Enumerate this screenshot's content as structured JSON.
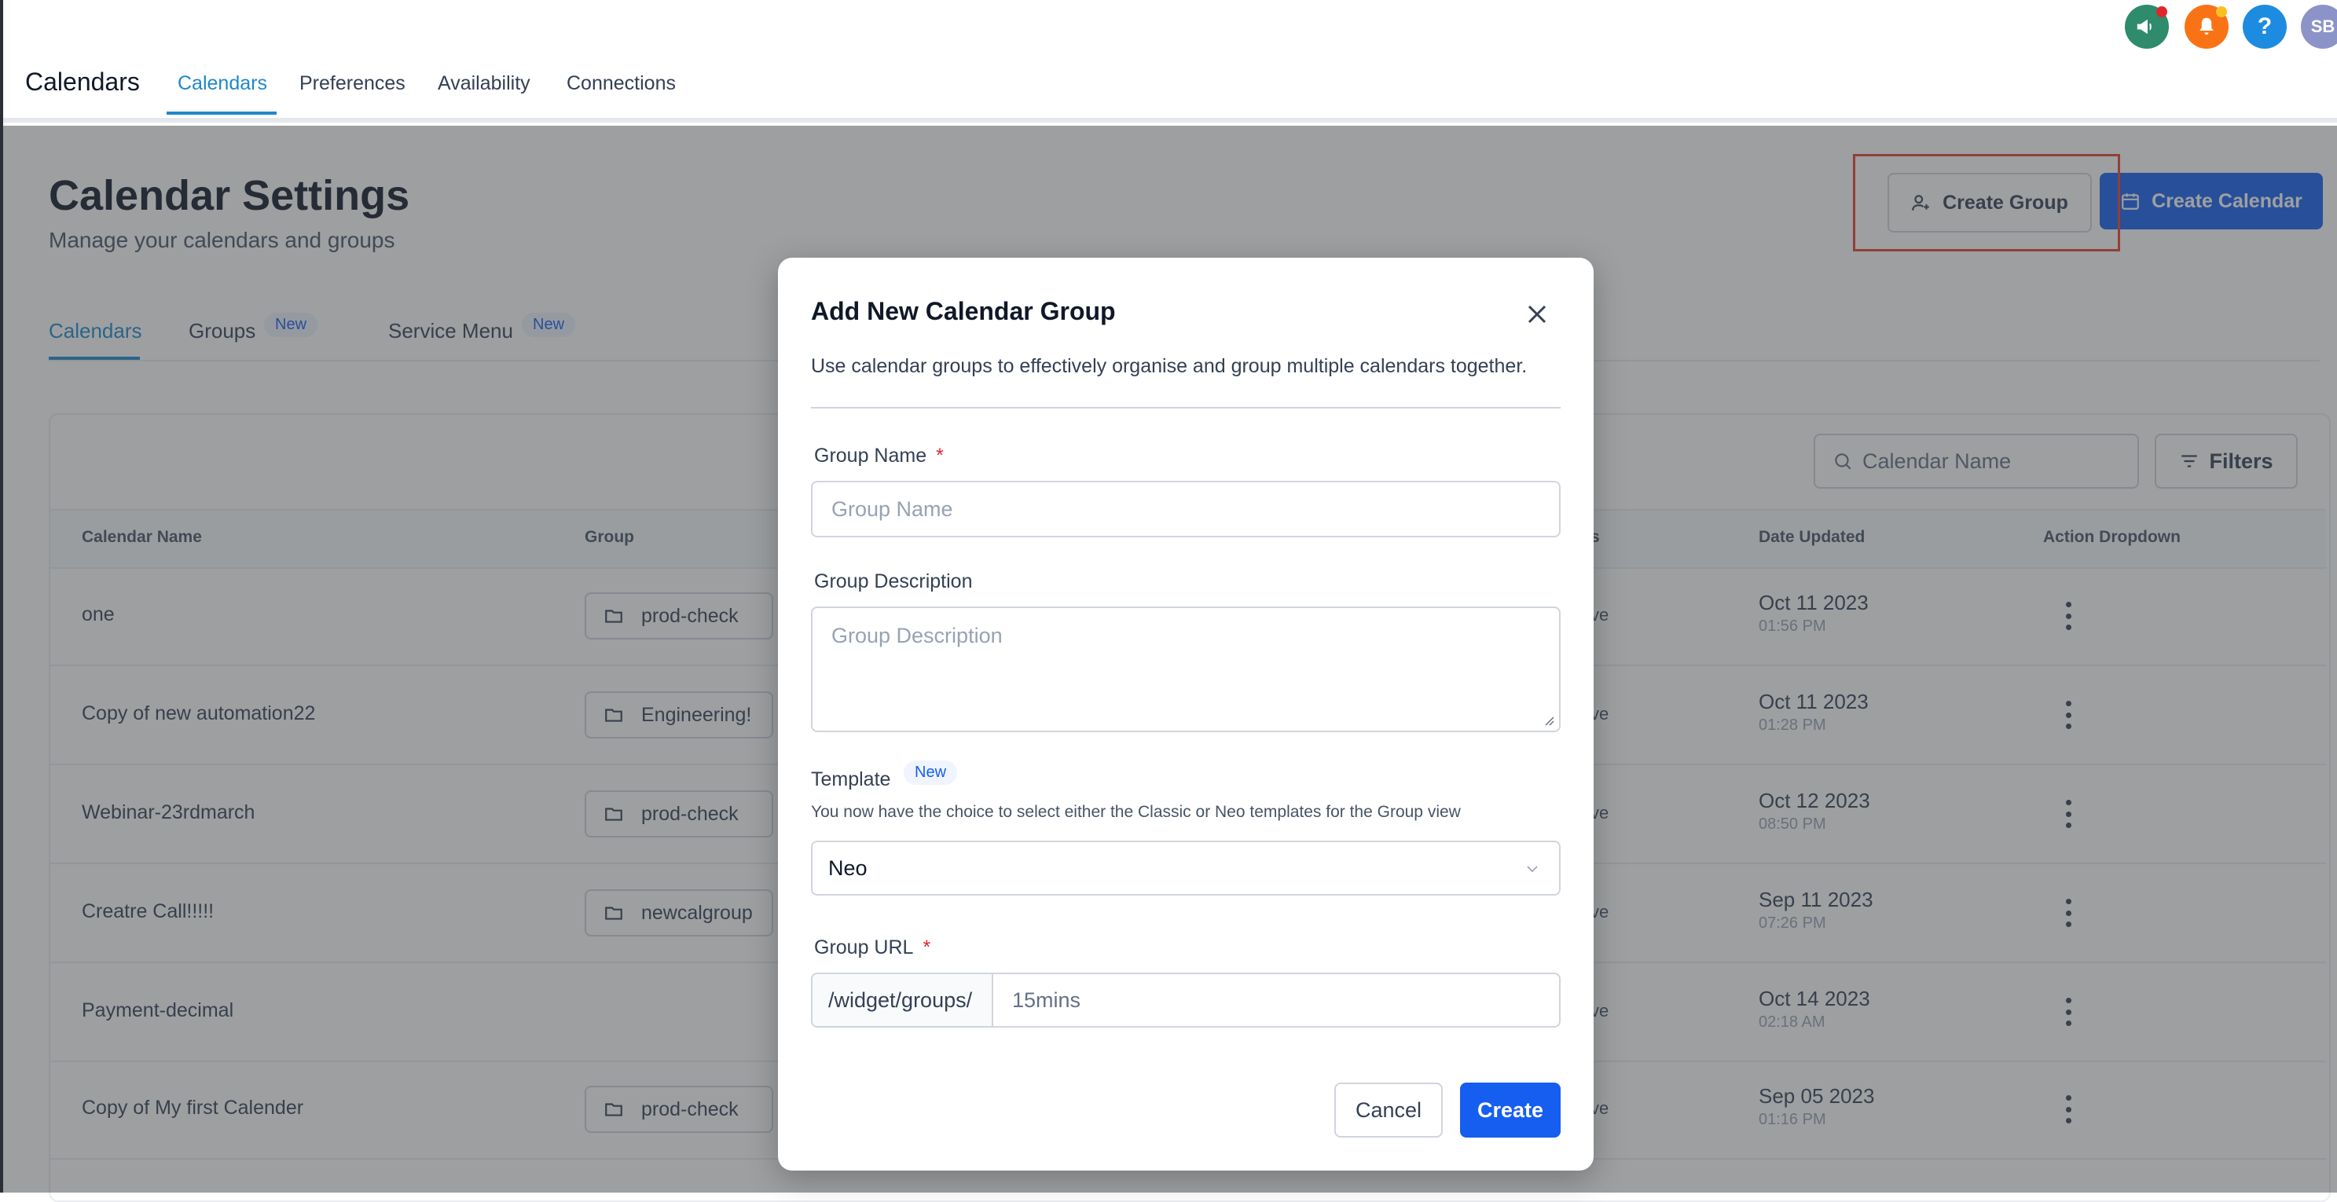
{
  "topbar": {
    "app_title": "Calendars",
    "tabs": [
      {
        "label": "Calendars",
        "active": true
      },
      {
        "label": "Preferences",
        "active": false
      },
      {
        "label": "Availability",
        "active": false
      },
      {
        "label": "Connections",
        "active": false
      }
    ],
    "icons": [
      {
        "name": "announcement-icon",
        "color": "#2e8b6b"
      },
      {
        "name": "notification-bell-icon",
        "color": "#f97316"
      },
      {
        "name": "help-icon",
        "color": "#1d8ce0"
      }
    ],
    "avatar_initials": "SB"
  },
  "page": {
    "title": "Calendar Settings",
    "subtitle": "Manage your calendars and groups",
    "create_group_label": "Create Group",
    "create_calendar_label": "Create Calendar",
    "sub_tabs": [
      {
        "label": "Calendars",
        "active": true
      },
      {
        "label": "Groups",
        "badge": "New"
      },
      {
        "label": "Service Menu",
        "badge": "New"
      }
    ],
    "search_placeholder": "Calendar Name",
    "filters_label": "Filters"
  },
  "table": {
    "columns": [
      "Calendar Name",
      "Group",
      "s",
      "Date Updated",
      "Action Dropdown"
    ],
    "rows": [
      {
        "name": "one",
        "group": "prod-check",
        "status": "ve",
        "date": "Oct 11 2023",
        "time": "01:56 PM"
      },
      {
        "name": "Copy of new automation22",
        "group": "Engineering!",
        "status": "ve",
        "date": "Oct 11 2023",
        "time": "01:28 PM"
      },
      {
        "name": "Webinar-23rdmarch",
        "group": "prod-check",
        "status": "ve",
        "date": "Oct 12 2023",
        "time": "08:50 PM"
      },
      {
        "name": "Creatre Call!!!!!",
        "group": "newcalgroup",
        "status": "ve",
        "date": "Sep 11 2023",
        "time": "07:26 PM"
      },
      {
        "name": "Payment-decimal",
        "group": "",
        "status": "ve",
        "date": "Oct 14 2023",
        "time": "02:18 AM"
      },
      {
        "name": "Copy of My first Calender",
        "group": "prod-check",
        "status": "ve",
        "date": "Sep 05 2023",
        "time": "01:16 PM"
      }
    ]
  },
  "modal": {
    "title": "Add New Calendar Group",
    "description": "Use calendar groups to effectively organise and group multiple calendars together.",
    "group_name_label": "Group Name",
    "group_name_placeholder": "Group Name",
    "required_mark": "*",
    "group_description_label": "Group Description",
    "group_description_placeholder": "Group Description",
    "template_label": "Template",
    "template_badge": "New",
    "template_hint": "You now have the choice to select either the Classic or Neo templates for the Group view",
    "template_value": "Neo",
    "group_url_label": "Group URL",
    "group_url_prefix": "/widget/groups/",
    "group_url_value": "15mins",
    "cancel_label": "Cancel",
    "create_label": "Create"
  },
  "colors": {
    "accent": "#155eef",
    "tab_active": "#1e88c9",
    "required": "#e0262b",
    "highlight_box": "#e8402a"
  }
}
